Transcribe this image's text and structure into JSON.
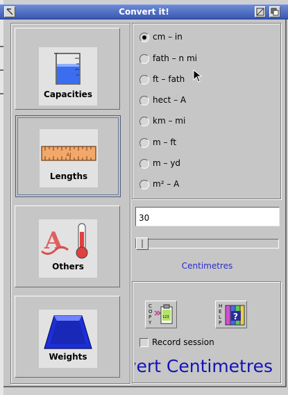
{
  "window": {
    "title": "Convert it!"
  },
  "categories": [
    {
      "label": "Capacities",
      "icon": "beaker-icon",
      "selected": false
    },
    {
      "label": "Lengths",
      "icon": "ruler-icon",
      "selected": true
    },
    {
      "label": "Others",
      "icon": "thermometer-icon",
      "selected": false
    },
    {
      "label": "Weights",
      "icon": "weight-icon",
      "selected": false
    }
  ],
  "conversions": [
    {
      "label": "cm – in",
      "checked": true
    },
    {
      "label": "fath – n mi",
      "checked": false
    },
    {
      "label": "ft – fath",
      "checked": false
    },
    {
      "label": "hect – A",
      "checked": false
    },
    {
      "label": "km – mi",
      "checked": false
    },
    {
      "label": "m – ft",
      "checked": false
    },
    {
      "label": "m – yd",
      "checked": false
    },
    {
      "label": "m² – A",
      "checked": false
    }
  ],
  "input": {
    "value": "30"
  },
  "slider": {
    "position": 0.0
  },
  "unit": {
    "label": "Centimetres"
  },
  "actions": {
    "copy_icon": "copy-icon",
    "help_icon": "help-icon",
    "record_label": "Record session",
    "record_checked": false
  },
  "status": {
    "text": "Convert Centimetres"
  },
  "colors": {
    "titlebar": "#3a58b3",
    "accent_text": "#2a2acd",
    "status_text": "#1212b8"
  },
  "ruler_text": "AI"
}
